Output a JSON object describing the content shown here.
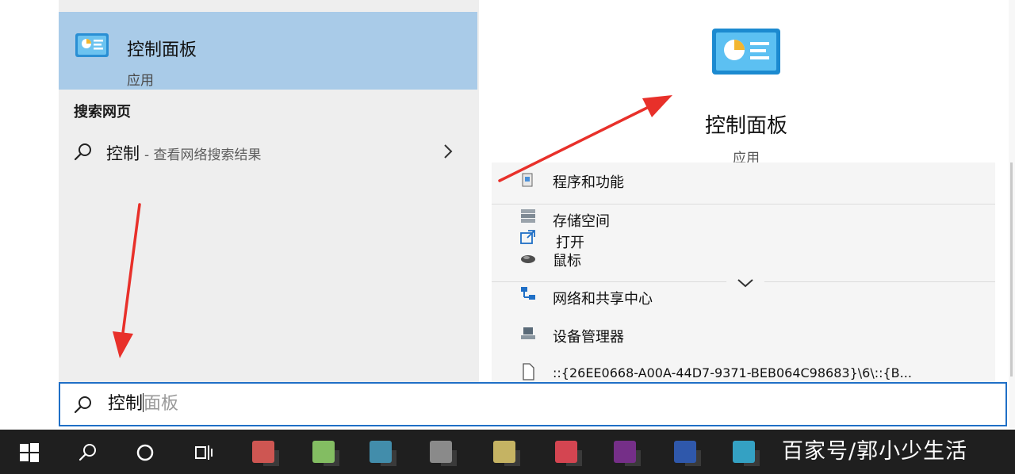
{
  "best_match": {
    "title": "控制面板",
    "subtitle": "应用"
  },
  "web_section": {
    "heading": "搜索网页",
    "term": "控制",
    "description": "- 查看网络搜索结果"
  },
  "detail": {
    "title": "控制面板",
    "subtitle": "应用",
    "actions": [
      {
        "label": "程序和功能",
        "icon": "programs-icon"
      },
      {
        "label": "存储空间",
        "icon": "storage-icon"
      },
      {
        "label": "打开",
        "icon": "open-icon"
      },
      {
        "label": "鼠标",
        "icon": "mouse-icon"
      },
      {
        "label": "网络和共享中心",
        "icon": "network-icon"
      },
      {
        "label": "设备管理器",
        "icon": "device-manager-icon"
      },
      {
        "label": "::{26EE0668-A00A-44D7-9371-BEB064C98683}\\6\\::{B...",
        "icon": "file-icon"
      }
    ]
  },
  "search": {
    "typed": "控制",
    "suggestion": "面板"
  },
  "taskbar": {
    "buttons": [
      "windows-start-icon",
      "search-icon",
      "cortana-icon",
      "task-view-icon"
    ],
    "app_colors": [
      "#d9534f",
      "#7fbf5a",
      "#3b8fb0",
      "#8a8a8a",
      "#c7b35a",
      "#e0424f",
      "#7a2d8f",
      "#2b58b5",
      "#2aa3c9",
      "#3b86c6",
      "#2f6fb0",
      "#4a90d9"
    ]
  },
  "watermark": "百家号/郭小少生活",
  "colors": {
    "selected_highlight": "#a9cbe8",
    "search_border": "#1f6fc6",
    "arrow": "#e8302a",
    "taskbar": "#1f1f1f"
  }
}
